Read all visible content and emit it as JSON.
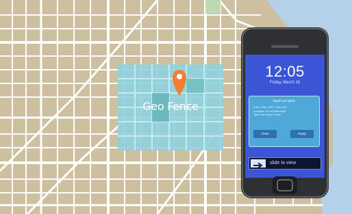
{
  "map": {
    "fence_label": "Geo Fence",
    "pin_icon": "location-pin-icon"
  },
  "phone": {
    "time": "12:05",
    "date": "Friday, March 16",
    "notification": {
      "title": "Tips/Food alerts:",
      "body_lines": [
        "Free 2 liter of RC Cola with",
        "purchase of Low Wannabe",
        "Take Our Repair Order"
      ],
      "close_label": "Close",
      "reply_label": "Reply"
    },
    "slide_label": "slide to view",
    "slide_icon": "arrow-right-icon"
  },
  "colors": {
    "land": "#ccc0a1",
    "water": "#b3d2ea",
    "roads": "#ffffff",
    "fence": "#8fd0de",
    "pin": "#f47f33",
    "phone_body": "#2e3133",
    "screen": "#3a55d6"
  }
}
